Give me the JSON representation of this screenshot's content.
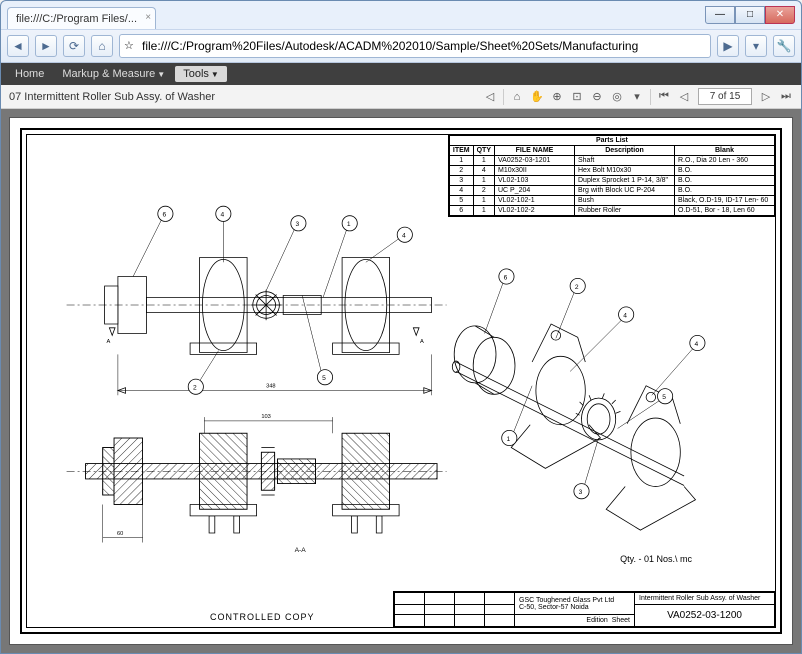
{
  "tab_title": "file:///C:/Program Files/...",
  "address": "file:///C:/Program%20Files/Autodesk/ACADM%202010/Sample/Sheet%20Sets/Manufacturing",
  "menu": {
    "home": "Home",
    "markup": "Markup & Measure",
    "tools": "Tools"
  },
  "doc_label": "07 Intermittent Roller Sub Assy. of Washer",
  "page_label": "7 of 15",
  "parts_list": {
    "title": "Parts List",
    "headers": [
      "ITEM",
      "QTY",
      "FILE NAME",
      "Description",
      "Blank"
    ],
    "rows": [
      [
        "1",
        "1",
        "VA0252-03-1201",
        "Shaft",
        "R.O., Dia 20 Len - 360"
      ],
      [
        "2",
        "4",
        "M10x30II",
        "Hex Bolt M10x30",
        "B.O."
      ],
      [
        "3",
        "1",
        "VL02-103",
        "Duplex Sprocket 1 P-14, 3/8\"",
        "B.O."
      ],
      [
        "4",
        "2",
        "UC P_204",
        "Brg with Block UC P-204",
        "B.O."
      ],
      [
        "5",
        "1",
        "VL02-102-1",
        "Bush",
        "Black, O.D-19, ID-17 Len- 60"
      ],
      [
        "6",
        "1",
        "VL02-102-2",
        "Rubber Roller",
        "O.D-51, Bor - 18, Len 60"
      ]
    ]
  },
  "titleblock": {
    "company": "GSC Toughened Glass Pvt Ltd",
    "addr": "C-50, Sector-57 Noida",
    "drawing_title": "Intermittent Roller Sub Assy. of Washer",
    "drawing_no": "VA0252-03-1200",
    "edition": "Edition",
    "sheet": "Sheet"
  },
  "qty_text": "Qty. - 01 Nos.\\ mc",
  "controlled": "CONTROLLED COPY",
  "section_labels": {
    "A1": "A",
    "A2": "A",
    "AA": "A-A"
  },
  "dims": {
    "d1": "348"
  }
}
